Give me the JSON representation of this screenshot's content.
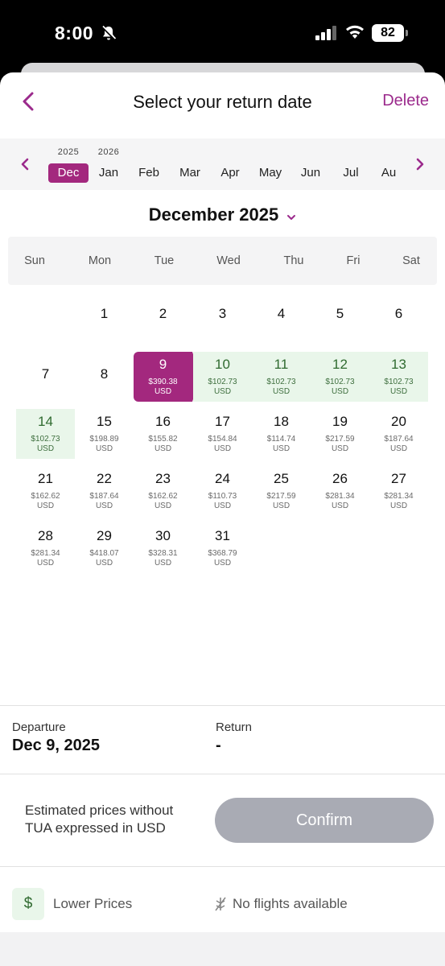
{
  "status_bar": {
    "time": "8:00",
    "battery": "82"
  },
  "header": {
    "title": "Select your return date",
    "delete_label": "Delete"
  },
  "month_strip": {
    "items": [
      {
        "year": "2025",
        "name": "Dec",
        "selected": true
      },
      {
        "year": "2026",
        "name": "Jan"
      },
      {
        "year": "",
        "name": "Feb"
      },
      {
        "year": "",
        "name": "Mar"
      },
      {
        "year": "",
        "name": "Apr"
      },
      {
        "year": "",
        "name": "May"
      },
      {
        "year": "",
        "name": "Jun"
      },
      {
        "year": "",
        "name": "Jul"
      },
      {
        "year": "",
        "name": "Au"
      }
    ]
  },
  "calendar": {
    "month_title": "December 2025",
    "weekdays": [
      "Sun",
      "Mon",
      "Tue",
      "Wed",
      "Thu",
      "Fri",
      "Sat"
    ],
    "currency": "USD",
    "days": [
      {
        "d": "1",
        "price": ""
      },
      {
        "d": "2",
        "price": ""
      },
      {
        "d": "3",
        "price": ""
      },
      {
        "d": "4",
        "price": ""
      },
      {
        "d": "5",
        "price": ""
      },
      {
        "d": "6",
        "price": ""
      },
      {
        "d": "7",
        "price": ""
      },
      {
        "d": "8",
        "price": ""
      },
      {
        "d": "9",
        "price": "$390.38",
        "state": "selected"
      },
      {
        "d": "10",
        "price": "$102.73",
        "state": "low"
      },
      {
        "d": "11",
        "price": "$102.73",
        "state": "low"
      },
      {
        "d": "12",
        "price": "$102.73",
        "state": "low"
      },
      {
        "d": "13",
        "price": "$102.73",
        "state": "low"
      },
      {
        "d": "14",
        "price": "$102.73",
        "state": "low"
      },
      {
        "d": "15",
        "price": "$198.89"
      },
      {
        "d": "16",
        "price": "$155.82"
      },
      {
        "d": "17",
        "price": "$154.84"
      },
      {
        "d": "18",
        "price": "$114.74"
      },
      {
        "d": "19",
        "price": "$217.59"
      },
      {
        "d": "20",
        "price": "$187.64"
      },
      {
        "d": "21",
        "price": "$162.62"
      },
      {
        "d": "22",
        "price": "$187.64"
      },
      {
        "d": "23",
        "price": "$162.62"
      },
      {
        "d": "24",
        "price": "$110.73"
      },
      {
        "d": "25",
        "price": "$217.59"
      },
      {
        "d": "26",
        "price": "$281.34"
      },
      {
        "d": "27",
        "price": "$281.34"
      },
      {
        "d": "28",
        "price": "$281.34"
      },
      {
        "d": "29",
        "price": "$418.07"
      },
      {
        "d": "30",
        "price": "$328.31"
      },
      {
        "d": "31",
        "price": "$368.79"
      }
    ]
  },
  "summary": {
    "departure_label": "Departure",
    "departure_value": "Dec 9, 2025",
    "return_label": "Return",
    "return_value": "-"
  },
  "footer": {
    "estimate_note": "Estimated prices without TUA expressed in USD",
    "confirm_label": "Confirm",
    "legend_symbol": "$",
    "legend_low": "Lower Prices",
    "legend_none": "No flights available"
  },
  "colors": {
    "accent": "#a3287e",
    "low_bg": "#e9f6ea",
    "low_text": "#2f6a2f",
    "confirm_disabled": "#a9abb4"
  }
}
